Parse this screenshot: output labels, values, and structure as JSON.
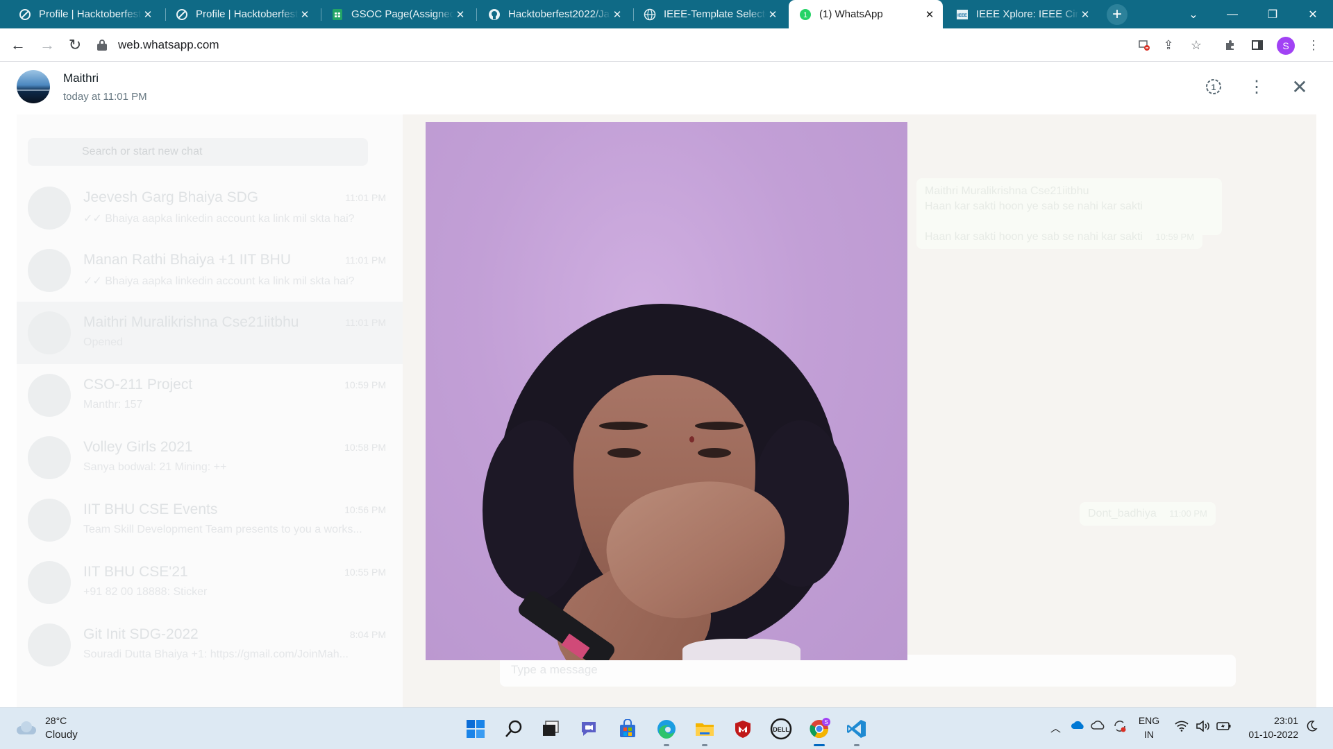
{
  "browser": {
    "tabs": [
      {
        "title": "Profile | Hacktoberfest",
        "icon": "hacktoberfest-icon"
      },
      {
        "title": "Profile | Hacktoberfest",
        "icon": "hacktoberfest-icon"
      },
      {
        "title": "GSOC Page(Assigned)",
        "icon": "google-sheets-icon"
      },
      {
        "title": "Hacktoberfest2022/Ja",
        "icon": "github-icon"
      },
      {
        "title": "IEEE-Template Selecto",
        "icon": "globe-icon"
      },
      {
        "title": "(1) WhatsApp",
        "icon": "whatsapp-icon",
        "active": true
      },
      {
        "title": "IEEE Xplore: IEEE Circ",
        "icon": "ieee-icon"
      }
    ],
    "url": "web.whatsapp.com",
    "profile_initial": "S"
  },
  "viewer": {
    "sender_name": "Maithri",
    "timestamp": "today at 11:01 PM",
    "media_description_icon": "photo"
  },
  "background": {
    "search_placeholder": "Search or start new chat",
    "chats": [
      {
        "name": "Jeevesh Garg Bhaiya SDG",
        "time": "11:01 PM",
        "preview": "✓✓ Bhaiya aapka linkedin account ka link mil skta hai?"
      },
      {
        "name": "Manan Rathi Bhaiya +1 IIT BHU",
        "time": "11:01 PM",
        "preview": "✓✓ Bhaiya aapka linkedin account ka link mil skta hai?"
      },
      {
        "name": "Maithri Muralikrishna Cse21iitbhu",
        "time": "11:01 PM",
        "preview": "Opened"
      },
      {
        "name": "CSO-211 Project",
        "time": "10:59 PM",
        "preview": "Manthr: 157"
      },
      {
        "name": "Volley Girls 2021",
        "time": "10:58 PM",
        "preview": "Sanya bodwal: 21 Mining: ++"
      },
      {
        "name": "IIT BHU CSE Events",
        "time": "10:56 PM",
        "preview": "Team Skill Development Team presents to you a works..."
      },
      {
        "name": "IIT BHU CSE'21",
        "time": "10:55 PM",
        "preview": "+91 82 00 18888: Sticker"
      },
      {
        "name": "Git Init SDG-2022",
        "time": "8:04 PM",
        "preview": "Souradi Dutta Bhaiya +1: https://gmail.com/JoinMah..."
      }
    ],
    "messages": [
      {
        "text": "Haan kar sakti hoon ye sab se nahi kar sakti",
        "time": "10:59 PM"
      },
      {
        "text": "Dont_badhiya",
        "time": "11:00 PM"
      }
    ],
    "quoted_name": "Maithri Muralikrishna Cse21iitbhu",
    "quoted_text": "Haan kar sakti hoon ye sab se nahi kar sakti",
    "input_placeholder": "Type a message"
  },
  "taskbar": {
    "weather_temp": "28°C",
    "weather_condition": "Cloudy",
    "lang_line1": "ENG",
    "lang_line2": "IN",
    "time": "23:01",
    "date": "01-10-2022",
    "chrome_badge": "S"
  }
}
